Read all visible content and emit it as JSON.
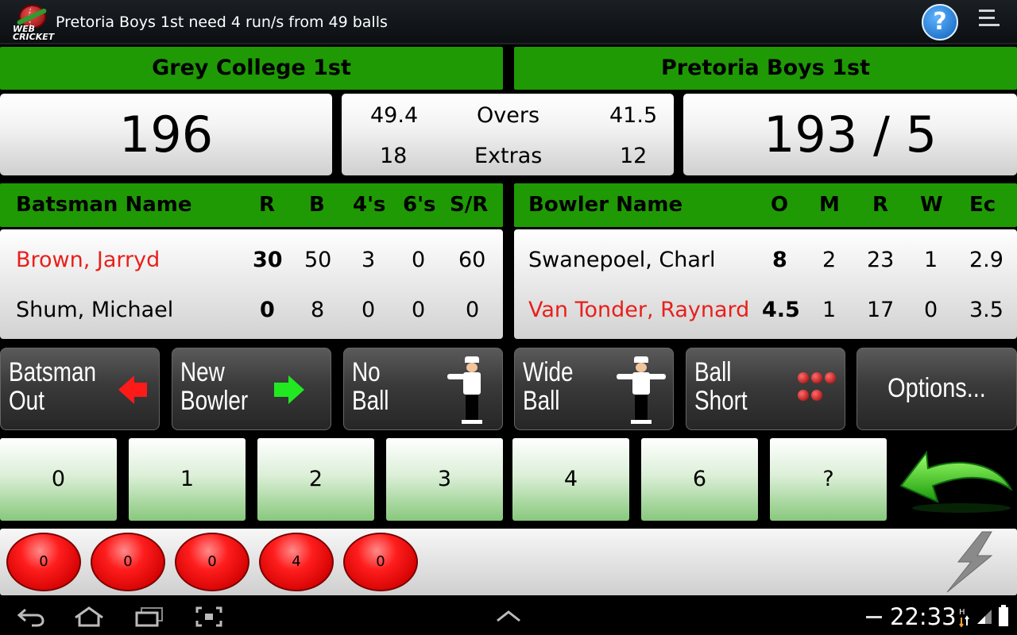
{
  "actionbar": {
    "title": "Pretoria Boys 1st need 4 run/s from 49 balls",
    "logo_text": "WEB CRICKET",
    "help_label": "?"
  },
  "teams": {
    "left": "Grey College 1st",
    "right": "Pretoria Boys 1st"
  },
  "scores": {
    "left_total": "196",
    "right_total": "193 / 5",
    "overs_label": "Overs",
    "overs_left": "49.4",
    "overs_right": "41.5",
    "extras_label": "Extras",
    "extras_left": "18",
    "extras_right": "12"
  },
  "batting": {
    "headers": [
      "Batsman Name",
      "R",
      "B",
      "4's",
      "6's",
      "S/R"
    ],
    "rows": [
      {
        "name": "Brown, Jarryd",
        "r": "30",
        "b": "50",
        "fours": "3",
        "sixes": "0",
        "sr": "60"
      },
      {
        "name": "Shum, Michael",
        "r": "0",
        "b": "8",
        "fours": "0",
        "sixes": "0",
        "sr": "0"
      }
    ]
  },
  "bowling": {
    "headers": [
      "Bowler Name",
      "O",
      "M",
      "R",
      "W",
      "Ec"
    ],
    "rows": [
      {
        "name": "Swanepoel, Charl",
        "o": "8",
        "m": "2",
        "r": "23",
        "w": "1",
        "ec": "2.9"
      },
      {
        "name": "Van Tonder, Raynard",
        "o": "4.5",
        "m": "1",
        "r": "17",
        "w": "0",
        "ec": "3.5"
      }
    ]
  },
  "actions": {
    "batsman_out": [
      "Batsman",
      "Out"
    ],
    "new_bowler": [
      "New",
      "Bowler"
    ],
    "no_ball": [
      "No",
      "Ball"
    ],
    "wide_ball": [
      "Wide",
      "Ball"
    ],
    "ball_short": [
      "Ball",
      "Short"
    ],
    "options": "Options..."
  },
  "runs": [
    "0",
    "1",
    "2",
    "3",
    "4",
    "6",
    "?"
  ],
  "over_balls": [
    "0",
    "0",
    "0",
    "4",
    "0"
  ],
  "status": {
    "time": "22:33"
  },
  "colors": {
    "green": "#1f9a05",
    "red_text": "#e8201c"
  }
}
